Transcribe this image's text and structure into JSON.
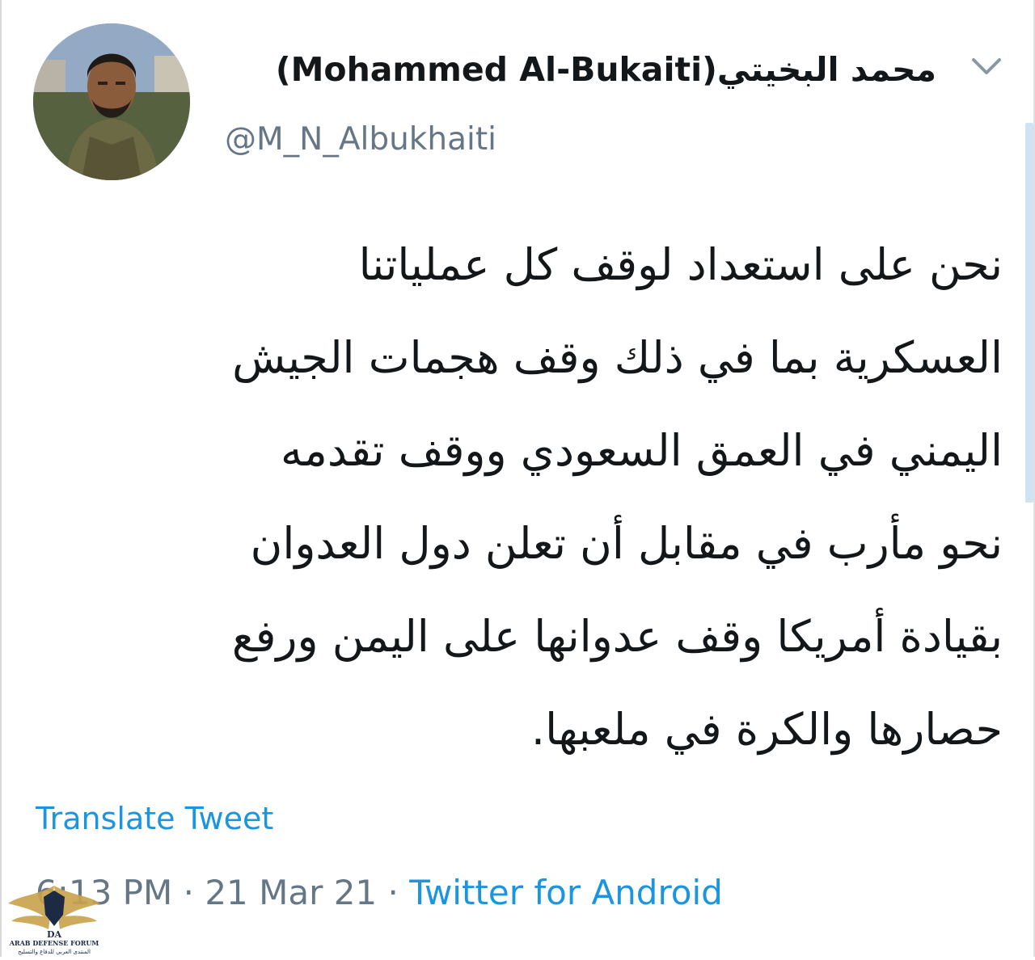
{
  "tweet": {
    "display_name_arabic": "محمد البخيتي",
    "display_name_latin": "(Mohammed Al-Bukaiti)",
    "handle": "@M_N_Albukhaiti",
    "body_lines": [
      "نحن على استعداد لوقف كل عملياتنا",
      "العسكرية بما في ذلك وقف هجمات الجيش",
      "اليمني في العمق السعودي ووقف تقدمه",
      "نحو مأرب في مقابل أن تعلن دول العدوان",
      "بقيادة أمريكا وقف عدوانها على اليمن ورفع",
      "حصارها والكرة في ملعبها."
    ],
    "translate_label": "Translate Tweet",
    "time": "6:13 PM",
    "separator": "·",
    "date": "21 Mar 21",
    "source": "Twitter for Android"
  },
  "icons": {
    "menu": "chevron-down-icon",
    "avatar": "profile-avatar"
  },
  "watermark": {
    "monogram": "DA",
    "title": "ARAB DEFENSE FORUM",
    "subtitle": "المنتدى العربي للدفاع والتسليح"
  },
  "colors": {
    "link": "#1b95e0",
    "text": "#14171a",
    "muted": "#657786"
  }
}
